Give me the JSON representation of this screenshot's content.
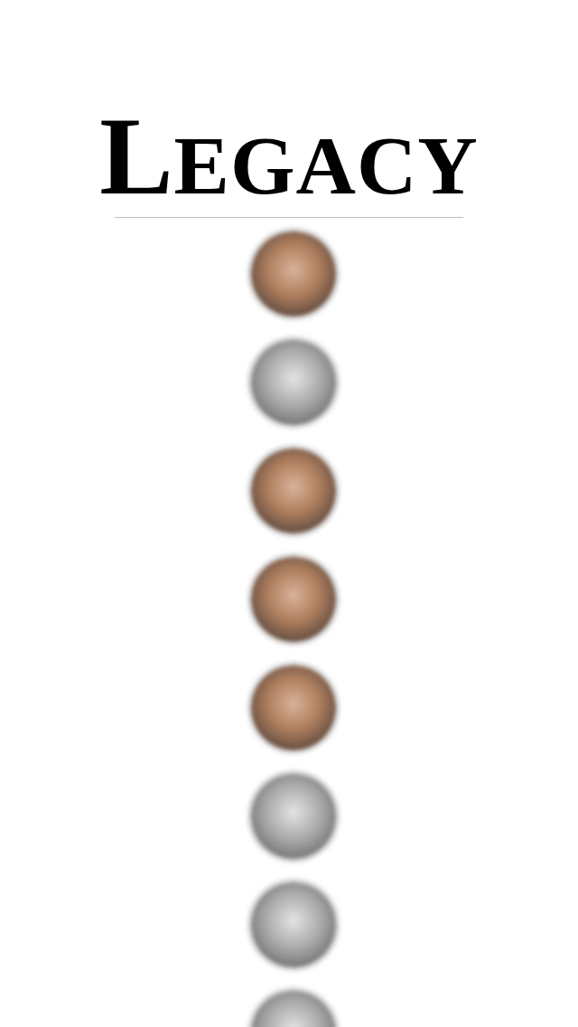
{
  "title": "LEGACY",
  "portraits": [
    {
      "kind": "color"
    },
    {
      "kind": "grayscale"
    },
    {
      "kind": "color"
    },
    {
      "kind": "color"
    },
    {
      "kind": "color"
    },
    {
      "kind": "grayscale"
    },
    {
      "kind": "grayscale"
    },
    {
      "kind": "grayscale"
    }
  ]
}
